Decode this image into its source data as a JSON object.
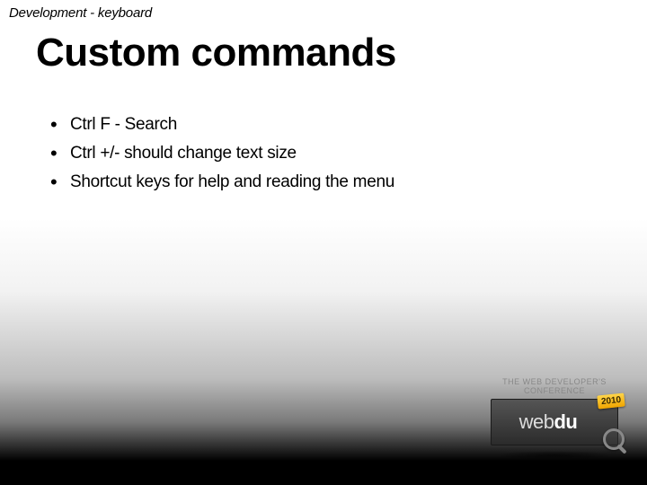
{
  "breadcrumb": "Development - keyboard",
  "title": "Custom commands",
  "bullets": [
    "Ctrl F - Search",
    "Ctrl +/- should change text size",
    "Shortcut keys for help and reading the menu"
  ],
  "logo": {
    "tagline": "THE WEB DEVELOPER'S CONFERENCE",
    "text_web": "web",
    "text_du": "du",
    "year": "2010"
  }
}
